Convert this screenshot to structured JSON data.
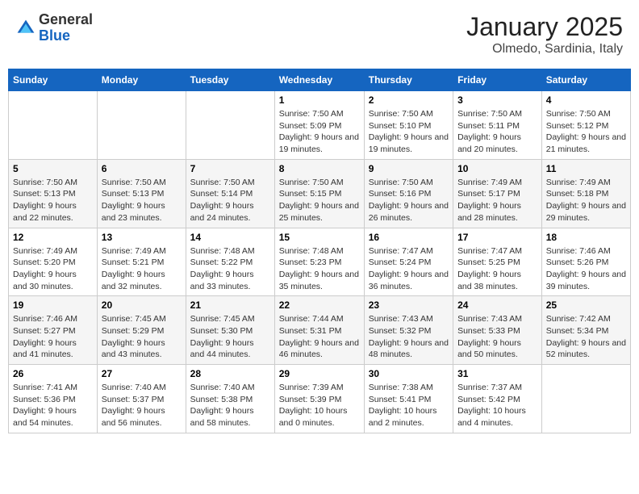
{
  "header": {
    "logo": {
      "general": "General",
      "blue": "Blue"
    },
    "title": "January 2025",
    "location": "Olmedo, Sardinia, Italy"
  },
  "days_of_week": [
    "Sunday",
    "Monday",
    "Tuesday",
    "Wednesday",
    "Thursday",
    "Friday",
    "Saturday"
  ],
  "weeks": [
    [
      {
        "day": "",
        "info": ""
      },
      {
        "day": "",
        "info": ""
      },
      {
        "day": "",
        "info": ""
      },
      {
        "day": "1",
        "sunrise": "Sunrise: 7:50 AM",
        "sunset": "Sunset: 5:09 PM",
        "daylight": "Daylight: 9 hours and 19 minutes."
      },
      {
        "day": "2",
        "sunrise": "Sunrise: 7:50 AM",
        "sunset": "Sunset: 5:10 PM",
        "daylight": "Daylight: 9 hours and 19 minutes."
      },
      {
        "day": "3",
        "sunrise": "Sunrise: 7:50 AM",
        "sunset": "Sunset: 5:11 PM",
        "daylight": "Daylight: 9 hours and 20 minutes."
      },
      {
        "day": "4",
        "sunrise": "Sunrise: 7:50 AM",
        "sunset": "Sunset: 5:12 PM",
        "daylight": "Daylight: 9 hours and 21 minutes."
      }
    ],
    [
      {
        "day": "5",
        "sunrise": "Sunrise: 7:50 AM",
        "sunset": "Sunset: 5:13 PM",
        "daylight": "Daylight: 9 hours and 22 minutes."
      },
      {
        "day": "6",
        "sunrise": "Sunrise: 7:50 AM",
        "sunset": "Sunset: 5:13 PM",
        "daylight": "Daylight: 9 hours and 23 minutes."
      },
      {
        "day": "7",
        "sunrise": "Sunrise: 7:50 AM",
        "sunset": "Sunset: 5:14 PM",
        "daylight": "Daylight: 9 hours and 24 minutes."
      },
      {
        "day": "8",
        "sunrise": "Sunrise: 7:50 AM",
        "sunset": "Sunset: 5:15 PM",
        "daylight": "Daylight: 9 hours and 25 minutes."
      },
      {
        "day": "9",
        "sunrise": "Sunrise: 7:50 AM",
        "sunset": "Sunset: 5:16 PM",
        "daylight": "Daylight: 9 hours and 26 minutes."
      },
      {
        "day": "10",
        "sunrise": "Sunrise: 7:49 AM",
        "sunset": "Sunset: 5:17 PM",
        "daylight": "Daylight: 9 hours and 28 minutes."
      },
      {
        "day": "11",
        "sunrise": "Sunrise: 7:49 AM",
        "sunset": "Sunset: 5:18 PM",
        "daylight": "Daylight: 9 hours and 29 minutes."
      }
    ],
    [
      {
        "day": "12",
        "sunrise": "Sunrise: 7:49 AM",
        "sunset": "Sunset: 5:20 PM",
        "daylight": "Daylight: 9 hours and 30 minutes."
      },
      {
        "day": "13",
        "sunrise": "Sunrise: 7:49 AM",
        "sunset": "Sunset: 5:21 PM",
        "daylight": "Daylight: 9 hours and 32 minutes."
      },
      {
        "day": "14",
        "sunrise": "Sunrise: 7:48 AM",
        "sunset": "Sunset: 5:22 PM",
        "daylight": "Daylight: 9 hours and 33 minutes."
      },
      {
        "day": "15",
        "sunrise": "Sunrise: 7:48 AM",
        "sunset": "Sunset: 5:23 PM",
        "daylight": "Daylight: 9 hours and 35 minutes."
      },
      {
        "day": "16",
        "sunrise": "Sunrise: 7:47 AM",
        "sunset": "Sunset: 5:24 PM",
        "daylight": "Daylight: 9 hours and 36 minutes."
      },
      {
        "day": "17",
        "sunrise": "Sunrise: 7:47 AM",
        "sunset": "Sunset: 5:25 PM",
        "daylight": "Daylight: 9 hours and 38 minutes."
      },
      {
        "day": "18",
        "sunrise": "Sunrise: 7:46 AM",
        "sunset": "Sunset: 5:26 PM",
        "daylight": "Daylight: 9 hours and 39 minutes."
      }
    ],
    [
      {
        "day": "19",
        "sunrise": "Sunrise: 7:46 AM",
        "sunset": "Sunset: 5:27 PM",
        "daylight": "Daylight: 9 hours and 41 minutes."
      },
      {
        "day": "20",
        "sunrise": "Sunrise: 7:45 AM",
        "sunset": "Sunset: 5:29 PM",
        "daylight": "Daylight: 9 hours and 43 minutes."
      },
      {
        "day": "21",
        "sunrise": "Sunrise: 7:45 AM",
        "sunset": "Sunset: 5:30 PM",
        "daylight": "Daylight: 9 hours and 44 minutes."
      },
      {
        "day": "22",
        "sunrise": "Sunrise: 7:44 AM",
        "sunset": "Sunset: 5:31 PM",
        "daylight": "Daylight: 9 hours and 46 minutes."
      },
      {
        "day": "23",
        "sunrise": "Sunrise: 7:43 AM",
        "sunset": "Sunset: 5:32 PM",
        "daylight": "Daylight: 9 hours and 48 minutes."
      },
      {
        "day": "24",
        "sunrise": "Sunrise: 7:43 AM",
        "sunset": "Sunset: 5:33 PM",
        "daylight": "Daylight: 9 hours and 50 minutes."
      },
      {
        "day": "25",
        "sunrise": "Sunrise: 7:42 AM",
        "sunset": "Sunset: 5:34 PM",
        "daylight": "Daylight: 9 hours and 52 minutes."
      }
    ],
    [
      {
        "day": "26",
        "sunrise": "Sunrise: 7:41 AM",
        "sunset": "Sunset: 5:36 PM",
        "daylight": "Daylight: 9 hours and 54 minutes."
      },
      {
        "day": "27",
        "sunrise": "Sunrise: 7:40 AM",
        "sunset": "Sunset: 5:37 PM",
        "daylight": "Daylight: 9 hours and 56 minutes."
      },
      {
        "day": "28",
        "sunrise": "Sunrise: 7:40 AM",
        "sunset": "Sunset: 5:38 PM",
        "daylight": "Daylight: 9 hours and 58 minutes."
      },
      {
        "day": "29",
        "sunrise": "Sunrise: 7:39 AM",
        "sunset": "Sunset: 5:39 PM",
        "daylight": "Daylight: 10 hours and 0 minutes."
      },
      {
        "day": "30",
        "sunrise": "Sunrise: 7:38 AM",
        "sunset": "Sunset: 5:41 PM",
        "daylight": "Daylight: 10 hours and 2 minutes."
      },
      {
        "day": "31",
        "sunrise": "Sunrise: 7:37 AM",
        "sunset": "Sunset: 5:42 PM",
        "daylight": "Daylight: 10 hours and 4 minutes."
      },
      {
        "day": "",
        "info": ""
      }
    ]
  ]
}
